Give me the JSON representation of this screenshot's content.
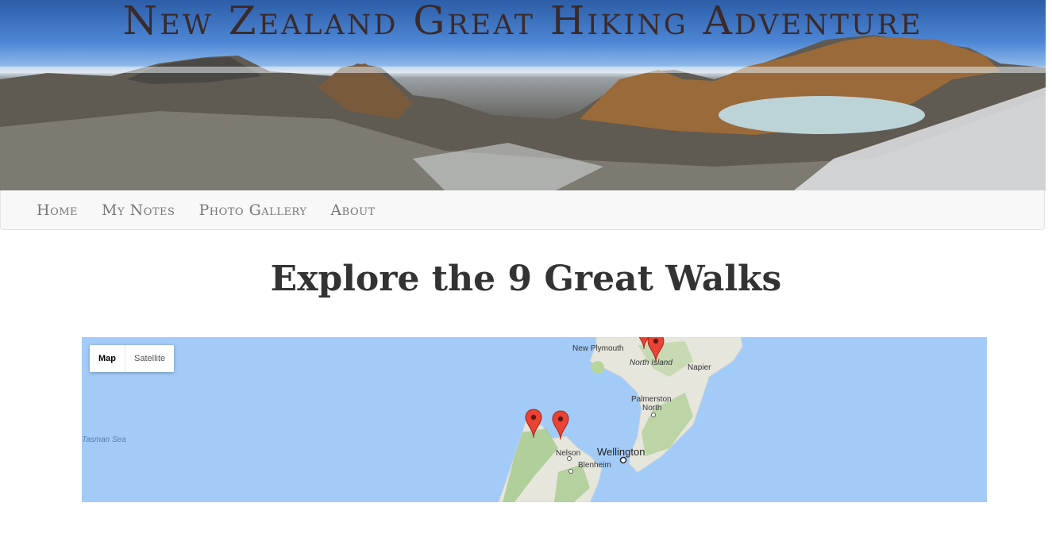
{
  "site": {
    "title": "New Zealand Great Hiking Adventure"
  },
  "nav": {
    "items": [
      {
        "label": "Home"
      },
      {
        "label": "My Notes"
      },
      {
        "label": "Photo Gallery"
      },
      {
        "label": "About"
      }
    ]
  },
  "main": {
    "heading": "Explore the 9 Great Walks"
  },
  "map": {
    "type_control": {
      "map_label": "Map",
      "satellite_label": "Satellite",
      "selected": "Map"
    },
    "labels": {
      "new_plymouth": "New Plymouth",
      "north_island": "North Island",
      "napier": "Napier",
      "palmerston": "Palmerston",
      "north": "North",
      "tasman_sea": "Tasman Sea",
      "nelson": "Nelson",
      "wellington": "Wellington",
      "blenheim": "Blenheim"
    },
    "colors": {
      "water": "#a2cbf8",
      "land": "#e8e8e0",
      "marker": "#ea4335"
    }
  }
}
